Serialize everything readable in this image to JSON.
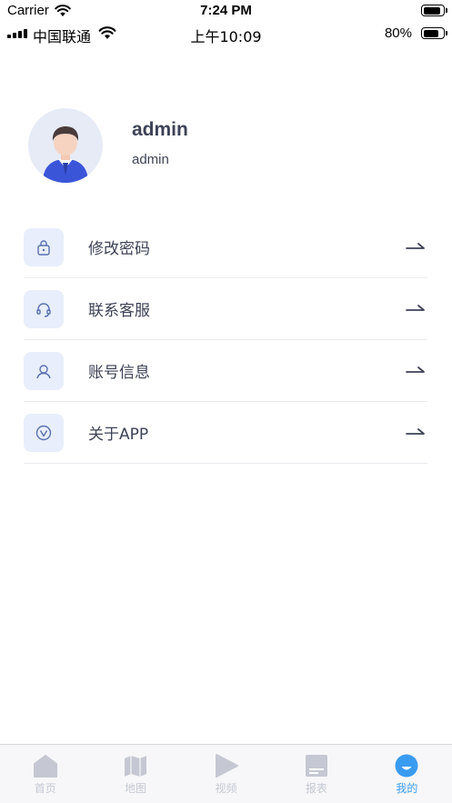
{
  "simulator_bar": {
    "carrier": "Carrier",
    "time": "7:24 PM"
  },
  "status_bar": {
    "carrier": "中国联通",
    "time": "上午10:09",
    "battery_percent": "80%",
    "battery_level": 0.8
  },
  "profile": {
    "username": "admin",
    "account": "admin",
    "avatar_icon": "user-avatar-icon"
  },
  "menu": {
    "items": [
      {
        "label": "修改密码",
        "icon": "lock-icon"
      },
      {
        "label": "联系客服",
        "icon": "headset-icon"
      },
      {
        "label": "账号信息",
        "icon": "person-icon"
      },
      {
        "label": "关于APP",
        "icon": "verified-v-icon"
      }
    ]
  },
  "tabbar": {
    "tabs": [
      {
        "label": "首页",
        "icon": "home-icon",
        "active": false
      },
      {
        "label": "地图",
        "icon": "map-icon",
        "active": false
      },
      {
        "label": "视频",
        "icon": "play-icon",
        "active": false
      },
      {
        "label": "报表",
        "icon": "report-icon",
        "active": false
      },
      {
        "label": "我的",
        "icon": "profile-smile-icon",
        "active": true
      }
    ]
  },
  "colors": {
    "accent": "#3a9cf0",
    "icon_bg": "#e8eefb",
    "text": "#3d4256",
    "tab_inactive": "#c5c8d2"
  }
}
